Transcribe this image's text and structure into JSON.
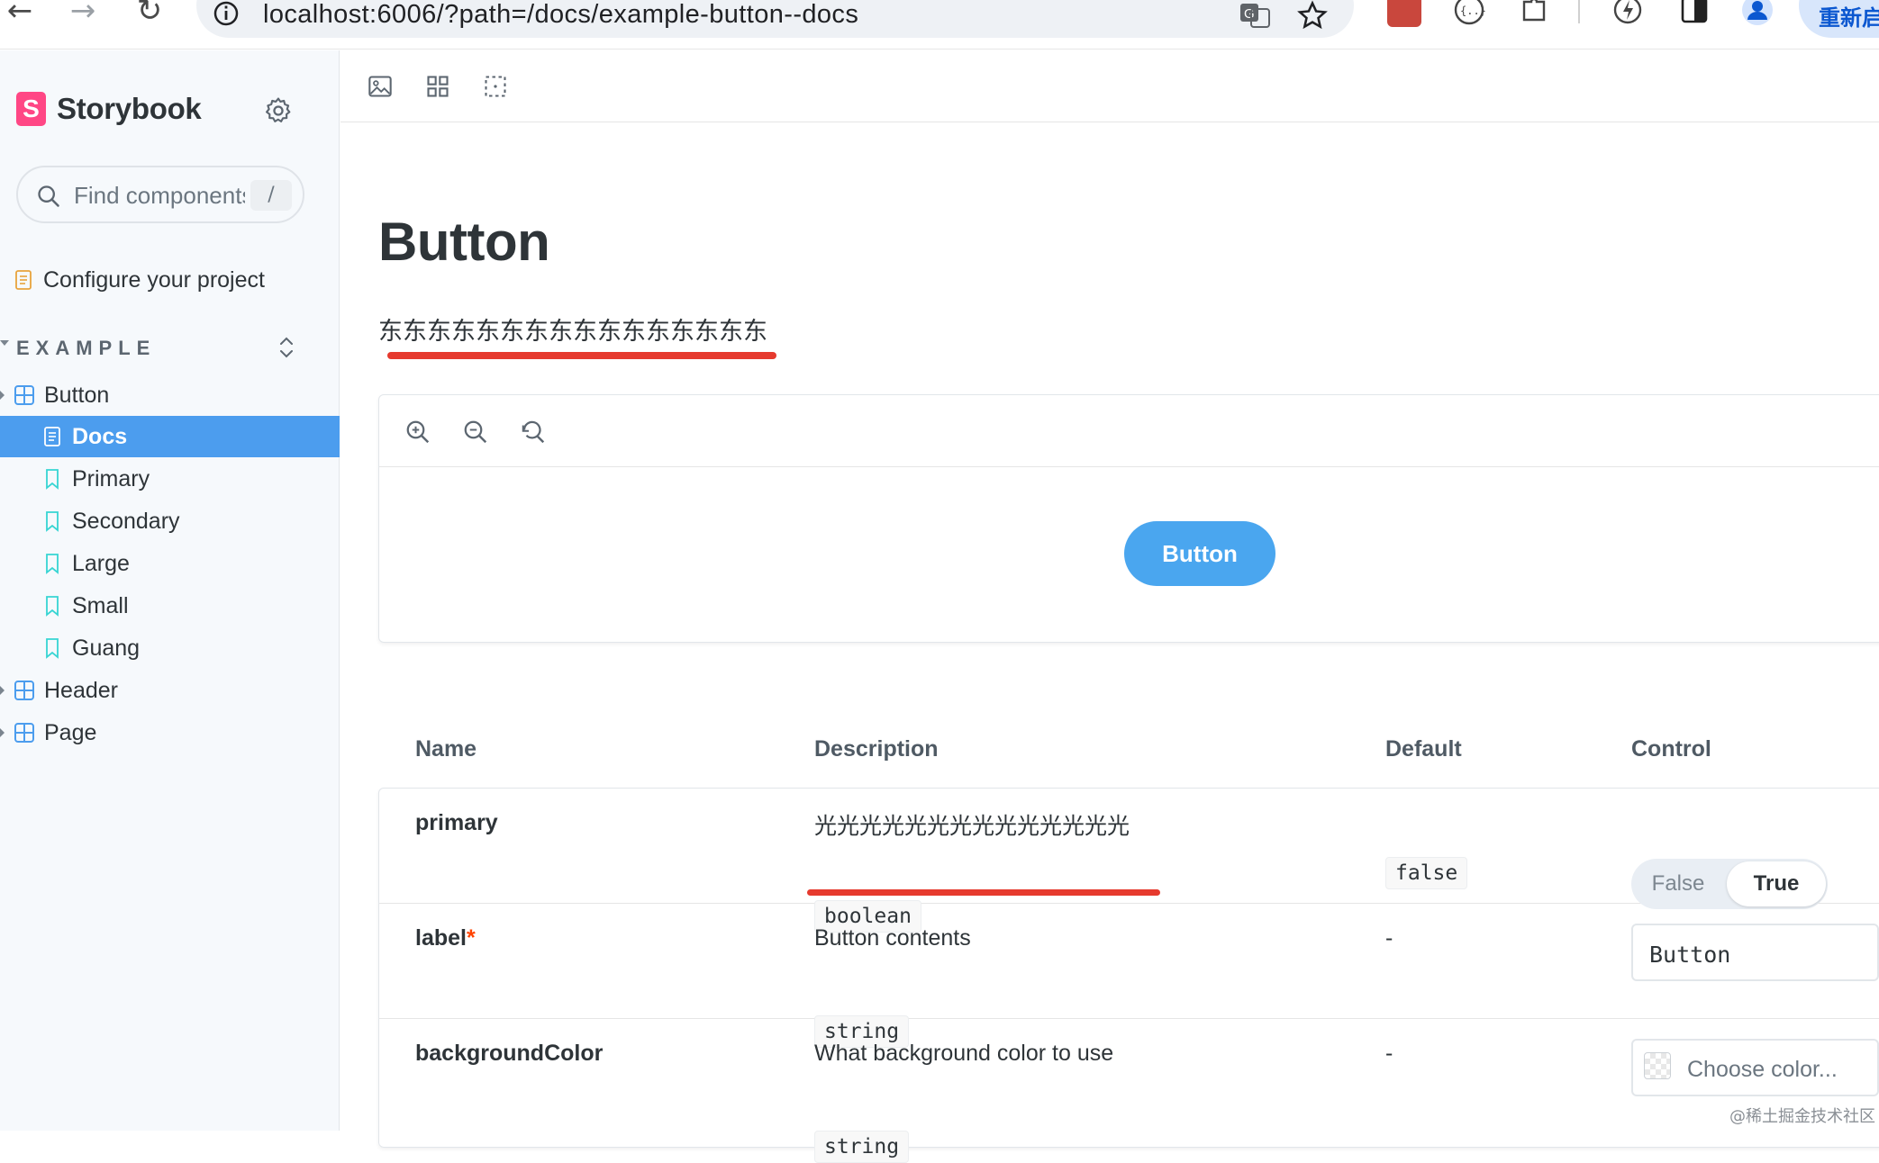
{
  "browser": {
    "url": "localhost:6006/?path=/docs/example-button--docs",
    "update_label": "重新启"
  },
  "sidebar": {
    "brand": "Storybook",
    "search_placeholder": "Find components",
    "search_shortcut": "/",
    "configure_label": "Configure your project",
    "section_label": "EXAMPLE",
    "items": [
      {
        "label": "Button",
        "kind": "component"
      },
      {
        "label": "Docs",
        "kind": "docs",
        "selected": true
      },
      {
        "label": "Primary",
        "kind": "story"
      },
      {
        "label": "Secondary",
        "kind": "story"
      },
      {
        "label": "Large",
        "kind": "story"
      },
      {
        "label": "Small",
        "kind": "story"
      },
      {
        "label": "Guang",
        "kind": "story"
      },
      {
        "label": "Header",
        "kind": "component"
      },
      {
        "label": "Page",
        "kind": "component"
      }
    ]
  },
  "main": {
    "title": "Button",
    "description": "东东东东东东东东东东东东东东东东",
    "preview_button_label": "Button"
  },
  "args_table": {
    "headers": [
      "Name",
      "Description",
      "Default",
      "Control"
    ],
    "rows": [
      {
        "name": "primary",
        "required": false,
        "description": "光光光光光光光光光光光光光光",
        "type": "boolean",
        "default": "false",
        "control": {
          "kind": "toggle",
          "options": [
            "False",
            "True"
          ],
          "selected": "True"
        }
      },
      {
        "name": "label",
        "required": true,
        "required_mark": "*",
        "description": "Button contents",
        "type": "string",
        "default": "-",
        "control": {
          "kind": "text",
          "value": "Button"
        }
      },
      {
        "name": "backgroundColor",
        "required": false,
        "description": "What background color to use",
        "type": "string",
        "default": "-",
        "control": {
          "kind": "color",
          "placeholder": "Choose color..."
        }
      }
    ]
  },
  "watermark": "@稀土掘金技术社区",
  "colors": {
    "accent": "#4c9dee",
    "brand": "#ff4785",
    "annotation": "#e63a2e",
    "preview_button": "#4aa6ef"
  }
}
